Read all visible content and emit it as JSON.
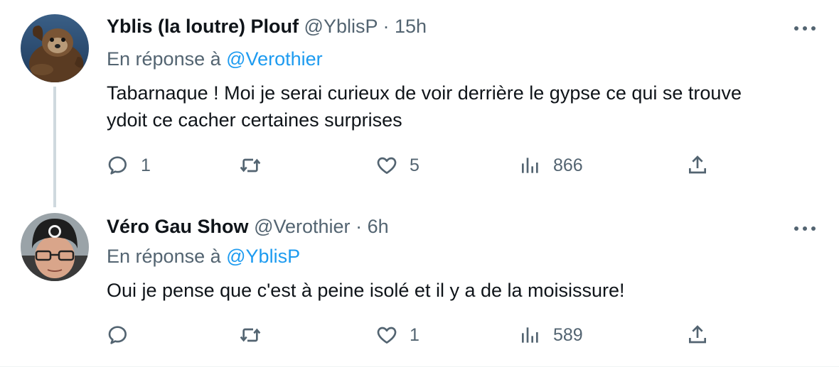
{
  "tweets": [
    {
      "name": "Yblis (la loutre) Plouf",
      "handle": "@YblisP",
      "dot": "·",
      "time": "15h",
      "reply_label": "En réponse à",
      "reply_mention": "@Verothier",
      "text_line1": "Tabarnaque !  Moi je serai curieux de voir derrière le gypse ce qui se trouve",
      "text_line2": "ydoit ce cacher certaines surprises",
      "replies": "1",
      "retweets": "",
      "likes": "5",
      "views": "866"
    },
    {
      "name": "Véro Gau Show",
      "handle": "@Verothier",
      "dot": "·",
      "time": "6h",
      "reply_label": "En réponse à",
      "reply_mention": "@YblisP",
      "text_line1": "Oui je pense que c'est à peine isolé et il y a de la moisissure!",
      "text_line2": "",
      "replies": "",
      "retweets": "",
      "likes": "1",
      "views": "589"
    }
  ],
  "icons": {
    "reply": "speech-bubble-icon",
    "retweet": "retweet-icon",
    "like": "heart-icon",
    "views": "bar-chart-icon",
    "share": "upload-icon",
    "more": "ellipsis-icon"
  },
  "colors": {
    "text": "#0f1419",
    "secondary": "#536471",
    "link": "#1d9bf0",
    "thread_line": "#cfd9de"
  }
}
